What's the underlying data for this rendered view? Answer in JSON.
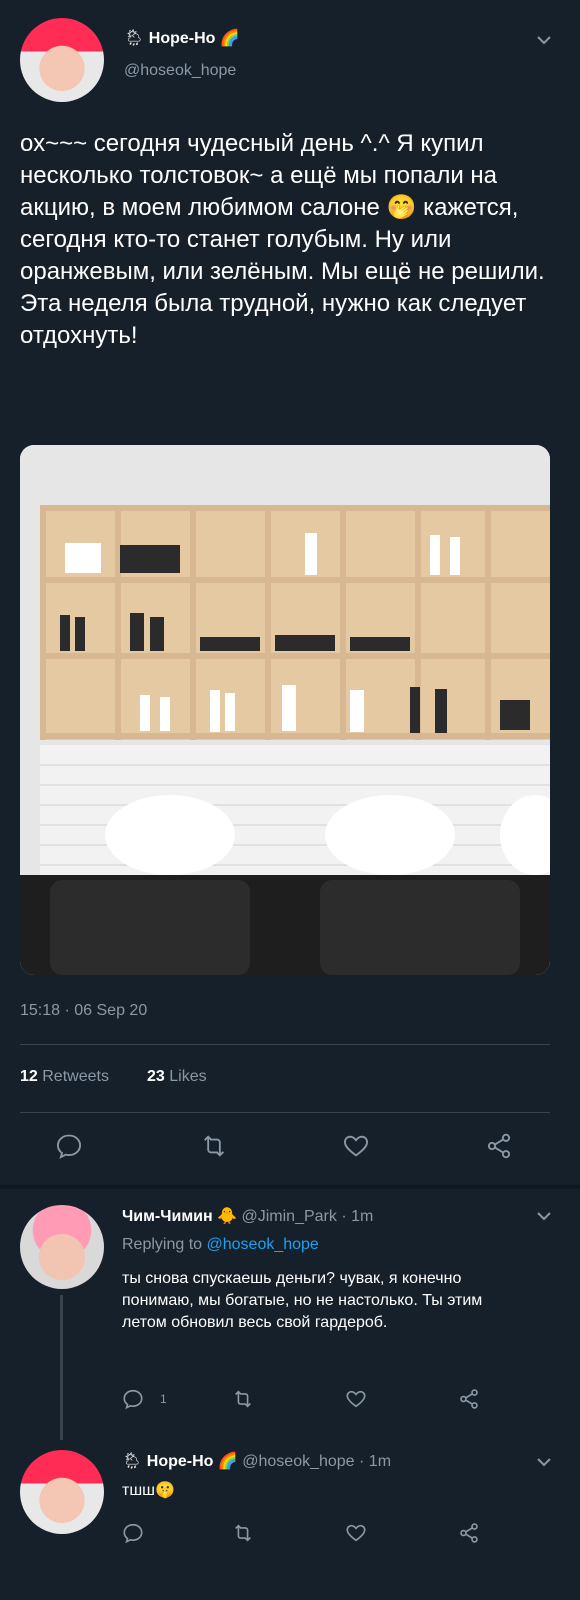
{
  "main_tweet": {
    "display_name": "Hope-Ho",
    "name_emoji": "🌦",
    "name_emoji2": "🌈",
    "handle": "@hoseok_hope",
    "text": "ох~~~ сегодня чудесный день ^.^  Я купил несколько толстовок~ а ещё мы попали на акцию, в моем любимом салоне 🤭 кажется, сегодня кто-то станет голубым. Ну или оранжевым, или зелёным. Мы ещё не решили. Эта неделя была трудной, нужно как следует отдохнуть!",
    "timestamp": "15:18 · 06 Sep 20",
    "retweets_count": "12",
    "retweets_label": "Retweets",
    "likes_count": "23",
    "likes_label": "Likes"
  },
  "reply1": {
    "display_name": "Чим-Чимин",
    "name_emoji": "🐥",
    "handle": "@Jimin_Park",
    "time": "· 1m",
    "replying_label": "Replying to",
    "replying_handle": "@hoseok_hope",
    "text": "ты снова спускаешь деньги? чувак, я конечно понимаю, мы богатые, но не настолько. Ты этим летом обновил весь свой гардероб.",
    "reply_count": "1"
  },
  "reply2": {
    "display_name": "Hope-Ho",
    "name_emoji": "🌦",
    "name_emoji2": "🌈",
    "handle": "@hoseok_hope",
    "time": "· 1m",
    "text": "тшш🤫"
  },
  "colors": {
    "background": "#15202b",
    "text": "#ffffff",
    "muted": "#8b98a5",
    "accent": "#1da1f2",
    "divider": "#38444d"
  }
}
